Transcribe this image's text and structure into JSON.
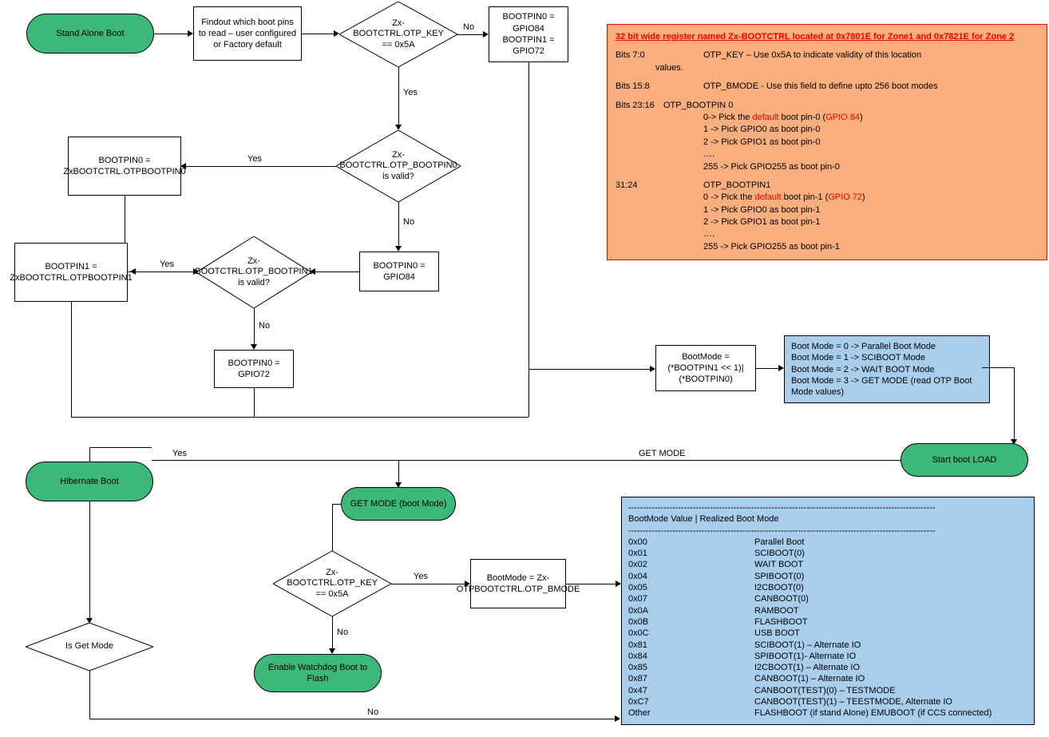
{
  "nodes": {
    "standAlone": "Stand Alone Boot",
    "findout": "Findout which boot pins to read – user configured or Factory default",
    "otpKey1": "Zx-BOOTCTRL.OTP_KEY == 0x5A",
    "bpDefault": "BOOTPIN0 = GPIO84\nBOOTPIN1 = GPIO72",
    "bp0otp": "BOOTPIN0 = ZxBOOTCTRL.OTPBOOTPIN0",
    "bp0valid": "Zx-BOOTCTRL.OTP_BOOTPIN0 is valid?",
    "bp0gpio84": "BOOTPIN0 = GPIO84",
    "bp1valid": "Zx-BOOTCTRL.OTP_BOOTPIN1 is valid?",
    "bp1otp": "BOOTPIN1 = ZxBOOTCTRL.OTPBOOTPIN1",
    "bp0gpio72": "BOOTPIN0 = GPIO72",
    "bootModeCalc": "BootMode = (*BOOTPIN1 << 1)|(*BOOTPIN0)",
    "startBootLoad": "Start boot LOAD",
    "hibernate": "Hibernate Boot",
    "isGetMode": "Is Get Mode",
    "getModeTerm": "GET MODE (boot Mode)",
    "otpKey2": "Zx-BOOTCTRL.OTP_KEY == 0x5A",
    "enableWdog": "Enable Watchdog Boot to Flash",
    "bModeAssign": "BootMode = Zx-OTPBOOTCTRL.OTP_BMODE"
  },
  "labels": {
    "yes": "Yes",
    "no": "No",
    "getMode": "GET MODE"
  },
  "noteOrange": {
    "title": "32 bit wide register named Zx-BOOTCTRL located at 0x7801E for Zone1 and 0x7821E for Zone 2",
    "row1a": "Bits 7:0",
    "row1b": "OTP_KEY – Use 0x5A to indicate validity of this location",
    "row1c": "values.",
    "row2a": "Bits 15:8",
    "row2b": "OTP_BMODE - Use this field to define upto 256 boot modes",
    "row3a": "Bits 23:16",
    "row3b": "OTP_BOOTPIN 0",
    "row3c_pre": "0-> Pick the ",
    "row3c_def": "default",
    "row3c_mid": " boot pin-0 (",
    "row3c_gpio": "GPIO 84",
    "row3c_post": ")",
    "row3d": "1 -> Pick GPIO0 as boot pin-0",
    "row3e": "2 -> Pick GPIO1 as boot pin-0",
    "row3f": "….",
    "row3g": "255 -> Pick GPIO255 as boot pin-0",
    "row4a": "31:24",
    "row4b": "OTP_BOOTPIN1",
    "row4c_pre": "0 -> Pick the ",
    "row4c_def": "default",
    "row4c_mid": " boot pin-1 (",
    "row4c_gpio": "GPIO 72",
    "row4c_post": ")",
    "row4d": "1 -> Pick GPIO0 as boot pin-1",
    "row4e": "2 -> Pick GPIO1 as boot pin-1",
    "row4f": "….",
    "row4g": "255 -> Pick GPIO255 as boot pin-1"
  },
  "bootModeList": {
    "l0": "Boot Mode = 0   -> Parallel Boot Mode",
    "l1": "Boot Mode = 1  -> SCIBOOT Mode",
    "l2": "Boot Mode = 2 -> WAIT BOOT Mode",
    "l3": "Boot Mode = 3 -> GET MODE (read OTP Boot Mode values)"
  },
  "bootModeTable": {
    "hr": "---------------------------------------------------------------------------------------------------------",
    "header": "BootMode Value  |  Realized Boot Mode",
    "rows": [
      [
        "0x00",
        "Parallel Boot"
      ],
      [
        "0x01",
        "SCIBOOT(0)"
      ],
      [
        "0x02",
        "WAIT BOOT"
      ],
      [
        "0x04",
        "SPIBOOT(0)"
      ],
      [
        "0x05",
        "I2CBOOT(0)"
      ],
      [
        "0x07",
        "CANBOOT(0)"
      ],
      [
        "0x0A",
        "RAMBOOT"
      ],
      [
        "0x0B",
        "FLASHBOOT"
      ],
      [
        "0x0C",
        "USB BOOT"
      ],
      [
        "0x81",
        "SCIBOOT(1) – Alternate IO"
      ],
      [
        "0x84",
        "SPIBOOT(1)- Alternate IO"
      ],
      [
        "0x85",
        "I2CBOOT(1) – Alternate IO"
      ],
      [
        "0x87",
        "CANBOOT(1) – Alternate IO"
      ],
      [
        "0x47",
        "CANBOOT(TEST)(0) – TESTMODE"
      ],
      [
        "0xC7",
        "CANBOOT(TEST)(1) – TEESTMODE, Alternate IO"
      ],
      [
        "Other",
        "FLASHBOOT (if stand Alone) EMUBOOT (if CCS connected)"
      ]
    ]
  }
}
